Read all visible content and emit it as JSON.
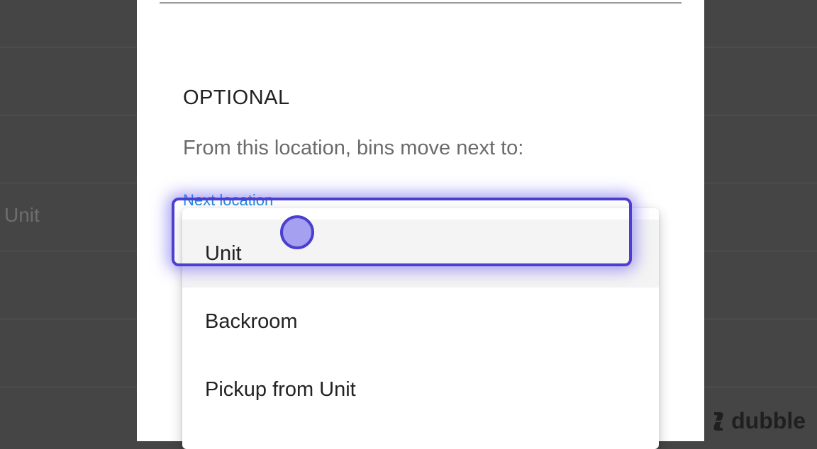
{
  "background": {
    "row_text": "Unit"
  },
  "modal": {
    "section_title": "OPTIONAL",
    "section_description": "From this location, bins move next to:",
    "field_label": "Next location"
  },
  "dropdown": {
    "selected_value": "Unit",
    "options": [
      {
        "label": "Unit"
      },
      {
        "label": "Backroom"
      },
      {
        "label": "Pickup from Unit"
      }
    ]
  },
  "colors": {
    "accent": "#4b3fcf",
    "link": "#1e88e5",
    "overlay": "#454545"
  },
  "watermark": {
    "text": "dubble"
  }
}
